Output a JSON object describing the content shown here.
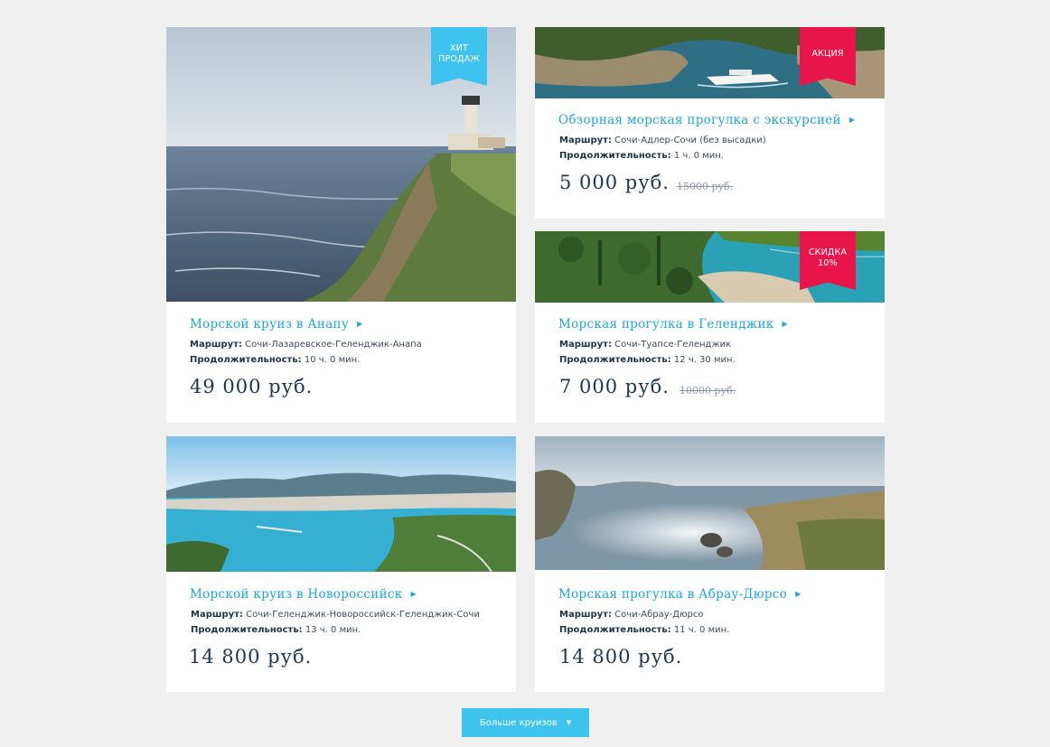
{
  "cards": [
    {
      "ribbon": [
        "ХИТ",
        "ПРОДАЖ"
      ],
      "title": "Морской круиз в Анапу",
      "route_label": "Маршрут:",
      "route": "Сочи-Лазаревское-Геленджик-Анапа",
      "duration_label": "Продолжительность:",
      "duration": "10 ч. 0 мин.",
      "price": "49 000 руб.",
      "old_price": ""
    },
    {
      "ribbon": [
        "АКЦИЯ"
      ],
      "title": "Обзорная морская прогулка с экскурсией",
      "route_label": "Маршрут:",
      "route": "Сочи-Адлер-Сочи (без высадки)",
      "duration_label": "Продолжительность:",
      "duration": "1 ч. 0 мин.",
      "price": "5 000 руб.",
      "old_price": "15000 руб."
    },
    {
      "ribbon": [
        "СКИДКА",
        "10%"
      ],
      "title": "Морская прогулка в Геленджик",
      "route_label": "Маршрут:",
      "route": "Сочи-Туапсе-Геленджик",
      "duration_label": "Продолжительность:",
      "duration": "12 ч. 30 мин.",
      "price": "7 000 руб.",
      "old_price": "10000 руб."
    },
    {
      "ribbon": [],
      "title": "Морской круиз в Новороссийск",
      "route_label": "Маршрут:",
      "route": "Сочи-Геленджик-Новороссийск-Геленджик-Сочи",
      "duration_label": "Продолжительность:",
      "duration": "13 ч. 0 мин.",
      "price": "14 800 руб.",
      "old_price": ""
    },
    {
      "ribbon": [],
      "title": "Морская прогулка в Абрау-Дюрсо",
      "route_label": "Маршрут:",
      "route": "Сочи-Абрау-Дюрсо",
      "duration_label": "Продолжительность:",
      "duration": "11 ч. 0 мин.",
      "price": "14 800 руб.",
      "old_price": ""
    }
  ],
  "more_button": {
    "label": "Больше круизов",
    "icon": "caret-down-icon"
  },
  "colors": {
    "accent": "#3dc3ee",
    "promo": "#e8154a",
    "title": "#1da5d9",
    "price": "#1d3550"
  }
}
